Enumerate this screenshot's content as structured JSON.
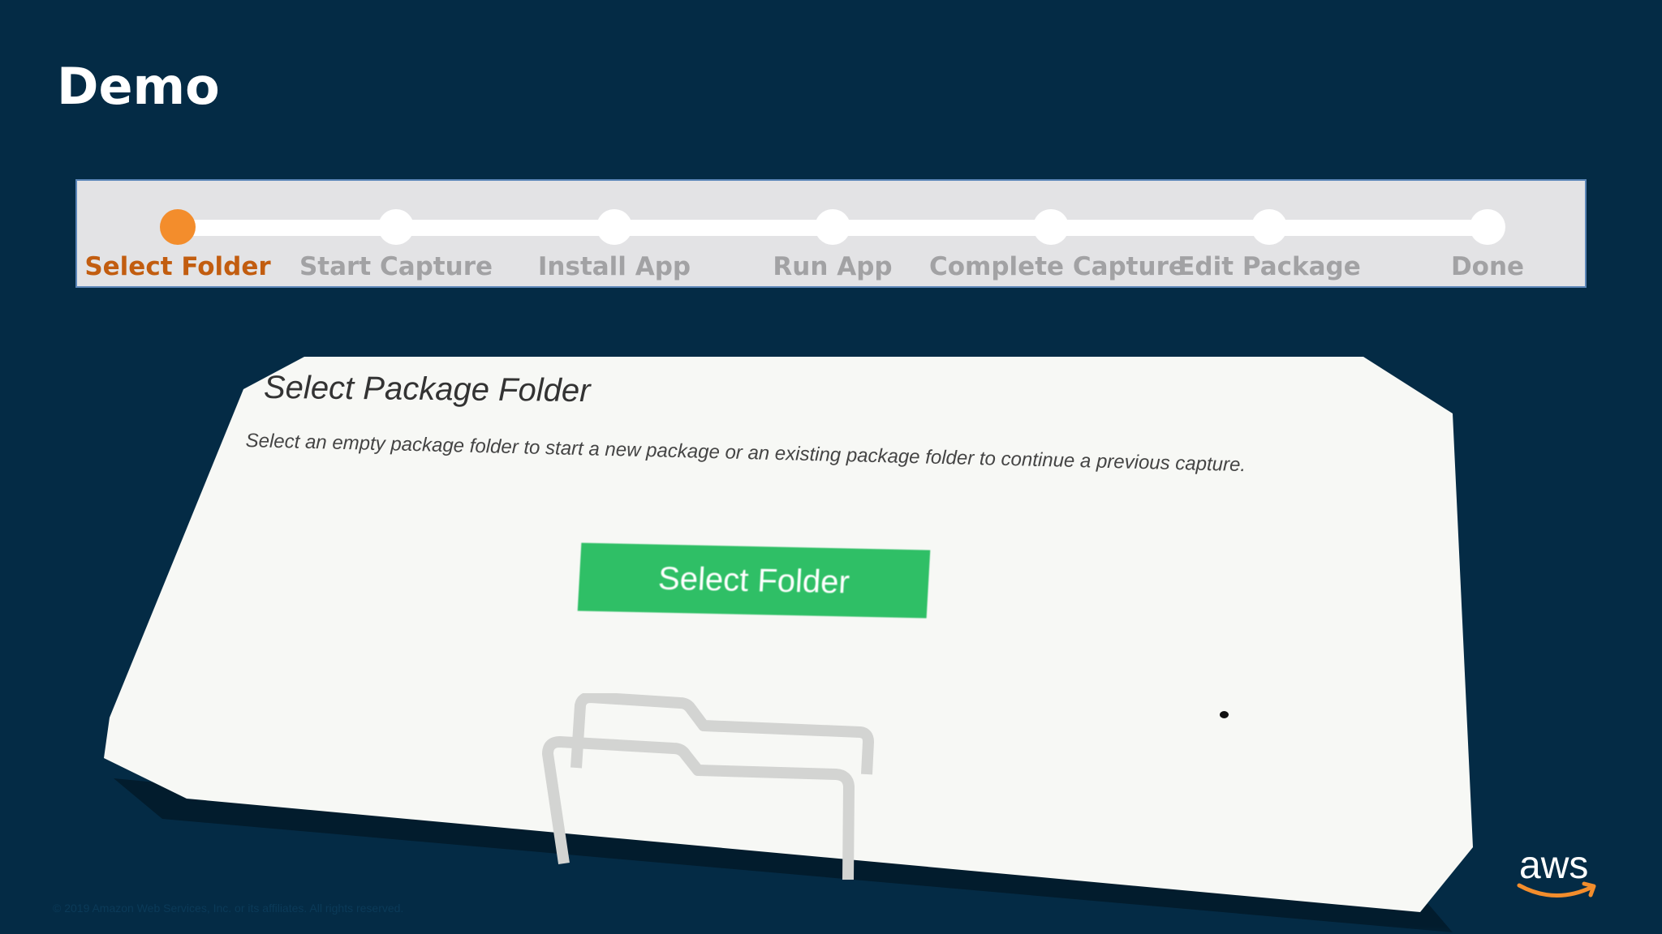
{
  "slide": {
    "title": "Demo",
    "copyright": "© 2019 Amazon Web Services, Inc. or its affiliates. All rights reserved."
  },
  "stepper": {
    "active_index": 0,
    "steps": [
      {
        "label": "Select Folder"
      },
      {
        "label": "Start Capture"
      },
      {
        "label": "Install App"
      },
      {
        "label": "Run App"
      },
      {
        "label": "Complete Capture"
      },
      {
        "label": "Edit Package"
      },
      {
        "label": "Done"
      }
    ]
  },
  "card": {
    "title": "Select Package Folder",
    "description": "Select an empty package folder to start a new package or an existing package folder to continue a previous capture.",
    "button_label": "Select Folder",
    "icon": "folder-icon"
  },
  "brand": {
    "logo_text": "aws",
    "accent_color": "#f38d2c",
    "button_color": "#2fbf66",
    "background_color": "#042b45"
  }
}
